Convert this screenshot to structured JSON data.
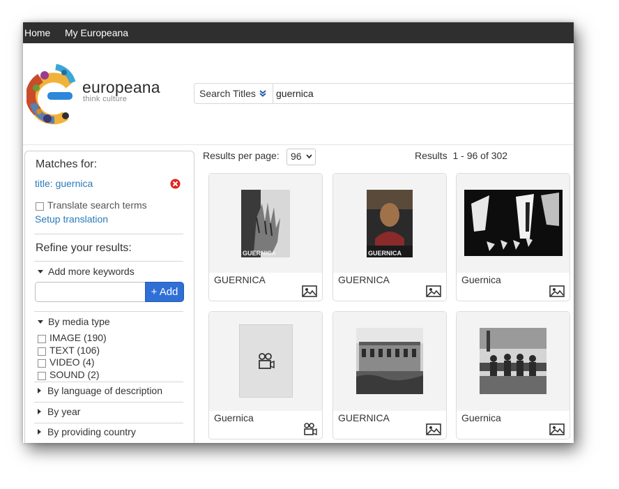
{
  "nav": {
    "home": "Home",
    "my": "My Europeana"
  },
  "logo": {
    "name": "europeana",
    "tagline": "think culture"
  },
  "search": {
    "type_label": "Search Titles",
    "query": "guernica"
  },
  "sidebar": {
    "matches_heading": "Matches for:",
    "match_term": "title: guernica",
    "translate_label": "Translate search terms",
    "setup_translation": "Setup translation",
    "refine_heading": "Refine your results:",
    "keywords_label": "Add more keywords",
    "add_button": "+ Add",
    "media_heading": "By media type",
    "media_options": [
      "IMAGE (190)",
      "TEXT (106)",
      "VIDEO (4)",
      "SOUND (2)"
    ],
    "language_label": "By language of description",
    "year_label": "By year",
    "country_label": "By providing country"
  },
  "results": {
    "per_page_label": "Results per page:",
    "per_page_value": "96",
    "count_label": "Results",
    "count_range": "1 - 96 of 302"
  },
  "items": [
    {
      "title": "GUERNICA",
      "type": "image-icon"
    },
    {
      "title": "GUERNICA",
      "type": "image-icon"
    },
    {
      "title": "Guernica",
      "type": "image-icon"
    },
    {
      "title": "Guernica",
      "type": "video-icon"
    },
    {
      "title": "GUERNICA",
      "type": "image-icon"
    },
    {
      "title": "Guernica",
      "type": "image-icon"
    }
  ],
  "thumb_texts": {
    "poster1": "GUERNICA",
    "poster2": "GUERNICA"
  },
  "colors": {
    "nav_bg": "#2f2f2f",
    "link": "#2a7ab8",
    "add_button": "#2f6fd6",
    "clear_icon": "#e0261f"
  }
}
